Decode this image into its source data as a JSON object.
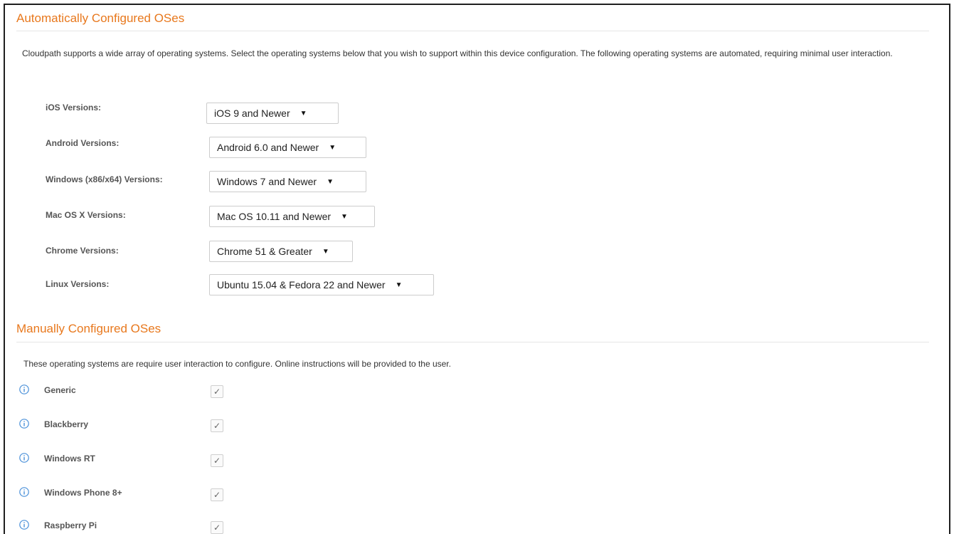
{
  "auto": {
    "title": "Automatically Configured OSes",
    "description": "Cloudpath supports a wide array of operating systems. Select the operating systems below that you wish to support within this device configuration. The following operating systems are automated, requiring minimal user interaction.",
    "rows": [
      {
        "label": "iOS Versions:",
        "value": "iOS 9 and Newer"
      },
      {
        "label": "Android Versions:",
        "value": "Android 6.0 and Newer"
      },
      {
        "label": "Windows (x86/x64) Versions:",
        "value": "Windows 7 and Newer"
      },
      {
        "label": "Mac OS X Versions:",
        "value": "Mac OS 10.11 and Newer"
      },
      {
        "label": "Chrome Versions:",
        "value": "Chrome 51 & Greater"
      },
      {
        "label": "Linux Versions:",
        "value": "Ubuntu 15.04 & Fedora 22 and Newer"
      }
    ],
    "caret": "▼"
  },
  "manual": {
    "title": "Manually Configured OSes",
    "description": "These operating systems are require user interaction to configure. Online instructions will be provided to the user.",
    "items": [
      {
        "label": "Generic",
        "checked": true
      },
      {
        "label": "Blackberry",
        "checked": true
      },
      {
        "label": "Windows RT",
        "checked": true
      },
      {
        "label": "Windows Phone 8+",
        "checked": true
      },
      {
        "label": "Raspberry Pi",
        "checked": true
      }
    ],
    "check_glyph": "✓"
  },
  "colors": {
    "accent": "#e8781d",
    "info": "#4a90d9",
    "border": "#1f1f1f"
  }
}
